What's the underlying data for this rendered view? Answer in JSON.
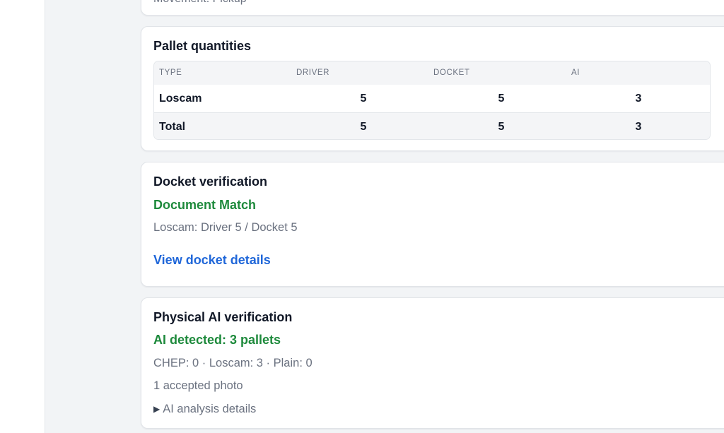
{
  "top_card": {
    "partial_text": "Movement: Pickup"
  },
  "pallet_quantities": {
    "title": "Pallet quantities",
    "columns": [
      "TYPE",
      "DRIVER",
      "DOCKET",
      "AI"
    ],
    "rows": [
      {
        "type": "Loscam",
        "driver": "5",
        "docket": "5",
        "ai": "3"
      }
    ],
    "total": {
      "type": "Total",
      "driver": "5",
      "docket": "5",
      "ai": "3"
    }
  },
  "docket_verification": {
    "title": "Docket verification",
    "status": "Document Match",
    "summary": "Loscam: Driver 5 / Docket 5",
    "link_label": "View docket details"
  },
  "ai_verification": {
    "title": "Physical AI verification",
    "status": "AI detected: 3 pallets",
    "breakdown": "CHEP: 0 · Loscam: 3 · Plain: 0",
    "photos": "1 accepted photo",
    "details_label": "AI analysis details"
  },
  "colors": {
    "success": "#1e8a3c",
    "link": "#2067d9",
    "muted": "#6b7280",
    "background": "#f2f4f6"
  }
}
